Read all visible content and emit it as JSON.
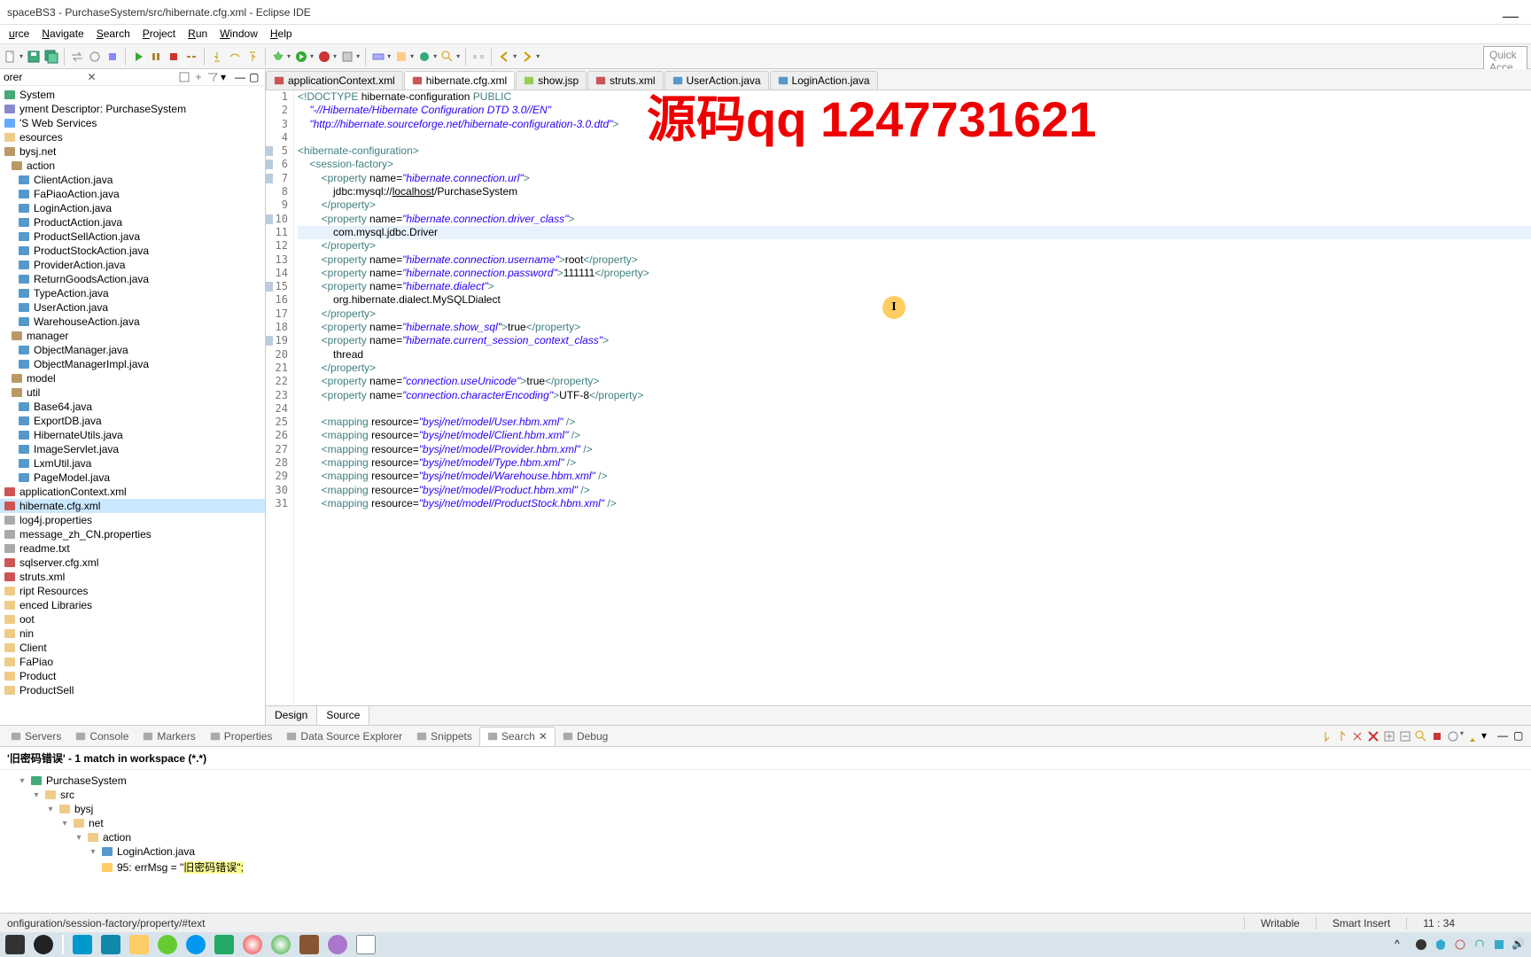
{
  "title": "spaceBS3 - PurchaseSystem/src/hibernate.cfg.xml - Eclipse IDE",
  "menu": [
    "urce",
    "Navigate",
    "Search",
    "Project",
    "Run",
    "Window",
    "Help"
  ],
  "quick_access": "Quick Acce",
  "explorer": {
    "items": [
      {
        "t": "System",
        "i": 0,
        "ic": "proj"
      },
      {
        "t": "yment Descriptor: PurchaseSystem",
        "i": 0,
        "ic": "desc"
      },
      {
        "t": "'S Web Services",
        "i": 0,
        "ic": "ws"
      },
      {
        "t": "esources",
        "i": 0,
        "ic": "fold"
      },
      {
        "t": "bysj.net",
        "i": 0,
        "ic": "pkg"
      },
      {
        "t": "action",
        "i": 1,
        "ic": "pkg"
      },
      {
        "t": "ClientAction.java",
        "i": 2,
        "ic": "java"
      },
      {
        "t": "FaPiaoAction.java",
        "i": 2,
        "ic": "java"
      },
      {
        "t": "LoginAction.java",
        "i": 2,
        "ic": "java"
      },
      {
        "t": "ProductAction.java",
        "i": 2,
        "ic": "java"
      },
      {
        "t": "ProductSellAction.java",
        "i": 2,
        "ic": "java"
      },
      {
        "t": "ProductStockAction.java",
        "i": 2,
        "ic": "java"
      },
      {
        "t": "ProviderAction.java",
        "i": 2,
        "ic": "java"
      },
      {
        "t": "ReturnGoodsAction.java",
        "i": 2,
        "ic": "java"
      },
      {
        "t": "TypeAction.java",
        "i": 2,
        "ic": "java"
      },
      {
        "t": "UserAction.java",
        "i": 2,
        "ic": "java"
      },
      {
        "t": "WarehouseAction.java",
        "i": 2,
        "ic": "java"
      },
      {
        "t": "manager",
        "i": 1,
        "ic": "pkg"
      },
      {
        "t": "ObjectManager.java",
        "i": 2,
        "ic": "java"
      },
      {
        "t": "ObjectManagerImpl.java",
        "i": 2,
        "ic": "java"
      },
      {
        "t": "model",
        "i": 1,
        "ic": "pkg"
      },
      {
        "t": "util",
        "i": 1,
        "ic": "pkg"
      },
      {
        "t": "Base64.java",
        "i": 2,
        "ic": "java"
      },
      {
        "t": "ExportDB.java",
        "i": 2,
        "ic": "java"
      },
      {
        "t": "HibernateUtils.java",
        "i": 2,
        "ic": "java"
      },
      {
        "t": "ImageServlet.java",
        "i": 2,
        "ic": "java"
      },
      {
        "t": "LxmUtil.java",
        "i": 2,
        "ic": "java"
      },
      {
        "t": "PageModel.java",
        "i": 2,
        "ic": "java"
      },
      {
        "t": "applicationContext.xml",
        "i": 0,
        "ic": "xml"
      },
      {
        "t": "hibernate.cfg.xml",
        "i": 0,
        "ic": "xml",
        "sel": true
      },
      {
        "t": "log4j.properties",
        "i": 0,
        "ic": "file"
      },
      {
        "t": "message_zh_CN.properties",
        "i": 0,
        "ic": "file"
      },
      {
        "t": "readme.txt",
        "i": 0,
        "ic": "file"
      },
      {
        "t": "sqlserver.cfg.xml",
        "i": 0,
        "ic": "xml"
      },
      {
        "t": "struts.xml",
        "i": 0,
        "ic": "xml"
      },
      {
        "t": "ript Resources",
        "i": 0,
        "ic": "fold"
      },
      {
        "t": "enced Libraries",
        "i": 0,
        "ic": "fold"
      },
      {
        "t": "oot",
        "i": 0,
        "ic": "fold"
      },
      {
        "t": "nin",
        "i": 0,
        "ic": "fold"
      },
      {
        "t": "Client",
        "i": 0,
        "ic": "fold"
      },
      {
        "t": "FaPiao",
        "i": 0,
        "ic": "fold"
      },
      {
        "t": "Product",
        "i": 0,
        "ic": "fold"
      },
      {
        "t": "ProductSell",
        "i": 0,
        "ic": "fold"
      }
    ]
  },
  "editor_tabs": [
    {
      "label": "applicationContext.xml",
      "icon": "xml"
    },
    {
      "label": "hibernate.cfg.xml",
      "icon": "xml",
      "active": true
    },
    {
      "label": "show.jsp",
      "icon": "jsp"
    },
    {
      "label": "struts.xml",
      "icon": "xml"
    },
    {
      "label": "UserAction.java",
      "icon": "java"
    },
    {
      "label": "LoginAction.java",
      "icon": "java"
    }
  ],
  "code": [
    {
      "n": 1,
      "h": "<span class='kw'>&lt;!DOCTYPE</span> <span class='txt'>hibernate-configuration</span> <span class='kw'>PUBLIC</span>"
    },
    {
      "n": 2,
      "h": "    <span class='str'>\"-//Hibernate/Hibernate Configuration DTD 3.0//EN\"</span>"
    },
    {
      "n": 3,
      "h": "    <span class='str'>\"http://hibernate.sourceforge.net/hibernate-configuration-3.0.dtd\"</span><span class='kw'>&gt;</span>"
    },
    {
      "n": 4,
      "h": ""
    },
    {
      "n": 5,
      "h": "<span class='kw'>&lt;hibernate-configuration&gt;</span>",
      "m": true
    },
    {
      "n": 6,
      "h": "    <span class='kw'>&lt;session-factory&gt;</span>",
      "m": true
    },
    {
      "n": 7,
      "h": "        <span class='kw'>&lt;property</span> <span class='txt'>name=</span><span class='str'>\"hibernate.connection.url\"</span><span class='kw'>&gt;</span>",
      "m": true
    },
    {
      "n": 8,
      "h": "            <span class='txt'>jdbc:mysql://<u>localhost</u>/PurchaseSystem</span>"
    },
    {
      "n": 9,
      "h": "        <span class='kw'>&lt;/property&gt;</span>"
    },
    {
      "n": 10,
      "h": "        <span class='kw'>&lt;property</span> <span class='txt'>name=</span><span class='str'>\"hibernate.connection.driver_class\"</span><span class='kw'>&gt;</span>",
      "m": true
    },
    {
      "n": 11,
      "h": "            <span class='txt'>com.mysql.jdbc.Driver</span>",
      "cur": true
    },
    {
      "n": 12,
      "h": "        <span class='kw'>&lt;/property&gt;</span>"
    },
    {
      "n": 13,
      "h": "        <span class='kw'>&lt;property</span> <span class='txt'>name=</span><span class='str'>\"hibernate.connection.username\"</span><span class='kw'>&gt;</span><span class='txt'>root</span><span class='kw'>&lt;/property&gt;</span>"
    },
    {
      "n": 14,
      "h": "        <span class='kw'>&lt;property</span> <span class='txt'>name=</span><span class='str'>\"hibernate.connection.password\"</span><span class='kw'>&gt;</span><span class='txt'>111111</span><span class='kw'>&lt;/property&gt;</span>"
    },
    {
      "n": 15,
      "h": "        <span class='kw'>&lt;property</span> <span class='txt'>name=</span><span class='str'>\"hibernate.dialect\"</span><span class='kw'>&gt;</span>",
      "m": true
    },
    {
      "n": 16,
      "h": "            <span class='txt'>org.hibernate.dialect.MySQLDialect</span>"
    },
    {
      "n": 17,
      "h": "        <span class='kw'>&lt;/property&gt;</span>"
    },
    {
      "n": 18,
      "h": "        <span class='kw'>&lt;property</span> <span class='txt'>name=</span><span class='str'>\"hibernate.show_sql\"</span><span class='kw'>&gt;</span><span class='txt'>true</span><span class='kw'>&lt;/property&gt;</span>"
    },
    {
      "n": 19,
      "h": "        <span class='kw'>&lt;property</span> <span class='txt'>name=</span><span class='str'>\"hibernate.current_session_context_class\"</span><span class='kw'>&gt;</span>",
      "m": true
    },
    {
      "n": 20,
      "h": "            <span class='txt'>thread</span>"
    },
    {
      "n": 21,
      "h": "        <span class='kw'>&lt;/property&gt;</span>"
    },
    {
      "n": 22,
      "h": "        <span class='kw'>&lt;property</span> <span class='txt'>name=</span><span class='str'>\"connection.useUnicode\"</span><span class='kw'>&gt;</span><span class='txt'>true</span><span class='kw'>&lt;/property&gt;</span>"
    },
    {
      "n": 23,
      "h": "        <span class='kw'>&lt;property</span> <span class='txt'>name=</span><span class='str'>\"connection.characterEncoding\"</span><span class='kw'>&gt;</span><span class='txt'>UTF-8</span><span class='kw'>&lt;/property&gt;</span>"
    },
    {
      "n": 24,
      "h": ""
    },
    {
      "n": 25,
      "h": "        <span class='kw'>&lt;mapping</span> <span class='txt'>resource=</span><span class='str'>\"bysj/net/model/User.hbm.xml\"</span> <span class='kw'>/&gt;</span>"
    },
    {
      "n": 26,
      "h": "        <span class='kw'>&lt;mapping</span> <span class='txt'>resource=</span><span class='str'>\"bysj/net/model/Client.hbm.xml\"</span> <span class='kw'>/&gt;</span>"
    },
    {
      "n": 27,
      "h": "        <span class='kw'>&lt;mapping</span> <span class='txt'>resource=</span><span class='str'>\"bysj/net/model/Provider.hbm.xml\"</span> <span class='kw'>/&gt;</span>"
    },
    {
      "n": 28,
      "h": "        <span class='kw'>&lt;mapping</span> <span class='txt'>resource=</span><span class='str'>\"bysj/net/model/Type.hbm.xml\"</span> <span class='kw'>/&gt;</span>"
    },
    {
      "n": 29,
      "h": "        <span class='kw'>&lt;mapping</span> <span class='txt'>resource=</span><span class='str'>\"bysj/net/model/Warehouse.hbm.xml\"</span> <span class='kw'>/&gt;</span>"
    },
    {
      "n": 30,
      "h": "        <span class='kw'>&lt;mapping</span> <span class='txt'>resource=</span><span class='str'>\"bysj/net/model/Product.hbm.xml\"</span> <span class='kw'>/&gt;</span>"
    },
    {
      "n": 31,
      "h": "        <span class='kw'>&lt;mapping</span> <span class='txt'>resource=</span><span class='str'>\"bysj/net/model/ProductStock.hbm.xml\"</span> <span class='kw'>/&gt;</span>"
    }
  ],
  "ed_bottom": {
    "design": "Design",
    "source": "Source"
  },
  "bottom_tabs": [
    "Servers",
    "Console",
    "Markers",
    "Properties",
    "Data Source Explorer",
    "Snippets",
    "Search",
    "Debug"
  ],
  "bottom_active": 6,
  "search_head": "'旧密码错误' - 1 match in workspace (*.*)",
  "search_tree": [
    {
      "i": 0,
      "exp": "▾",
      "ic": "proj",
      "t": "PurchaseSystem"
    },
    {
      "i": 1,
      "exp": "▾",
      "ic": "fold",
      "t": "src"
    },
    {
      "i": 2,
      "exp": "▾",
      "ic": "fold",
      "t": "bysj"
    },
    {
      "i": 3,
      "exp": "▾",
      "ic": "fold",
      "t": "net"
    },
    {
      "i": 4,
      "exp": "▾",
      "ic": "fold",
      "t": "action"
    },
    {
      "i": 5,
      "exp": "▾",
      "ic": "java",
      "t": "LoginAction.java"
    },
    {
      "i": 5,
      "exp": "",
      "ic": "match",
      "t": "95: errMsg = \"",
      "post": "旧密码错误\";"
    }
  ],
  "status": {
    "path": "onfiguration/session-factory/property/#text",
    "writable": "Writable",
    "insert": "Smart Insert",
    "pos": "11 : 34"
  },
  "watermark": "源码qq  1247731621"
}
